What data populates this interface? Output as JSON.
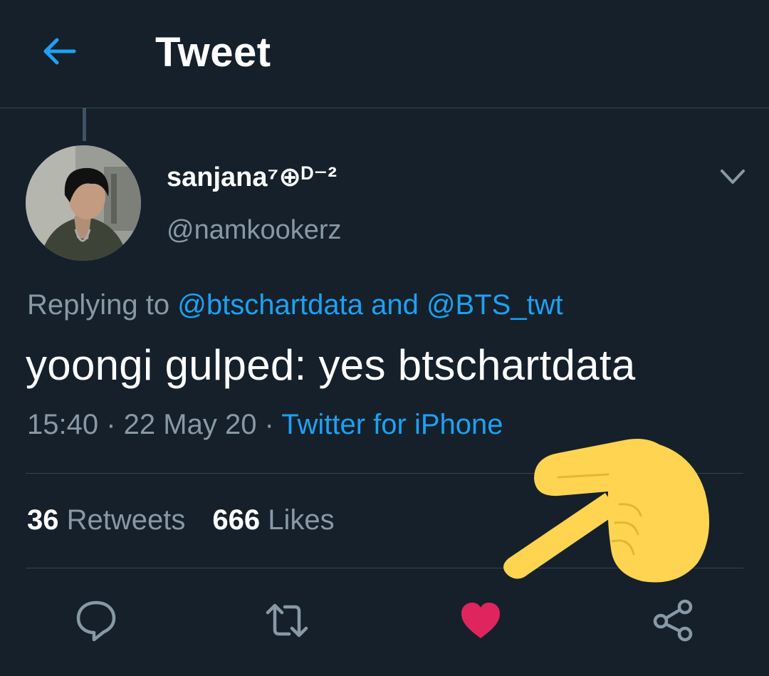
{
  "header": {
    "title": "Tweet",
    "back_icon": "arrow-left-icon"
  },
  "author": {
    "display_name": "sanjana⁷⊕ᴰ⁻²",
    "handle": "@namkookerz",
    "avatar_icon": "avatar-photo"
  },
  "reply_context": {
    "prefix": "Replying to ",
    "mention1": "@btschartdata",
    "conjunction": " and ",
    "mention2": "@BTS_twt"
  },
  "tweet": {
    "text": "yoongi gulped: yes btschartdata"
  },
  "meta": {
    "time": "15:40",
    "separator1": " · ",
    "date": "22 May 20",
    "separator2": " · ",
    "source": "Twitter for iPhone"
  },
  "stats": {
    "retweets_count": "36",
    "retweets_label": "Retweets",
    "likes_count": "666",
    "likes_label": "Likes"
  },
  "actions": {
    "reply_icon": "speech-bubble-icon",
    "retweet_icon": "retweet-arrows-icon",
    "like_icon": "heart-icon",
    "share_icon": "share-icon",
    "liked": true
  },
  "colors": {
    "background": "#15202b",
    "accent": "#1da1f2",
    "muted_text": "#8899a6",
    "like": "#e0245e",
    "hand_emoji": "#ffd451"
  },
  "overlay": {
    "icon": "pointing-hand-emoji"
  }
}
